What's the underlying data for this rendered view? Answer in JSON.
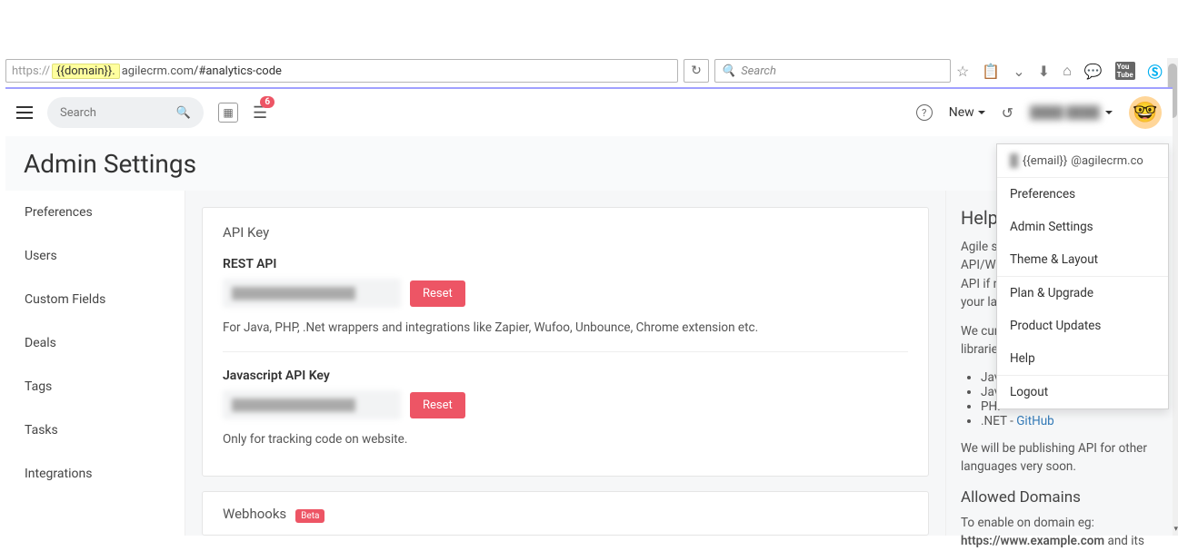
{
  "browser": {
    "url_scheme": "https://",
    "url_domain_placeholder": "{{domain}}.",
    "url_host": "agilecrm.com",
    "url_path": "/#analytics-code",
    "search_placeholder": "Search"
  },
  "topbar": {
    "search_placeholder": "Search",
    "badge_count": "6",
    "new_label": "New",
    "user_name": "████ ████"
  },
  "page_title": "Admin Settings",
  "sidebar": {
    "items": [
      {
        "label": "Preferences"
      },
      {
        "label": "Users"
      },
      {
        "label": "Custom Fields"
      },
      {
        "label": "Deals"
      },
      {
        "label": "Tags"
      },
      {
        "label": "Tasks"
      },
      {
        "label": "Integrations"
      }
    ]
  },
  "api_card": {
    "title": "API Key",
    "rest_label": "REST API",
    "rest_key": "████████████████",
    "rest_reset": "Reset",
    "rest_hint": "For Java, PHP, .Net wrappers and integrations like Zapier, Wufoo, Unbounce, Chrome extension etc.",
    "js_label": "Javascript API Key",
    "js_key": "████████████████",
    "js_reset": "Reset",
    "js_hint": "Only for tracking code on website."
  },
  "webhooks": {
    "title": "Webhooks",
    "badge": "Beta"
  },
  "help": {
    "title": "Help",
    "p1": "Agile supports multiple API/Wrappers. You can use REST API if no wrapper is supported for your language.",
    "p2": "We currently have the following libraries for Agile:",
    "items": [
      {
        "label": "Java",
        "link": ""
      },
      {
        "label": "Java",
        "link": ""
      },
      {
        "label": "PHP",
        "link": ""
      },
      {
        "label": ".NET - ",
        "link": "GitHub"
      }
    ],
    "p3": "We will be publishing API for other languages very soon.",
    "allowed_title": "Allowed Domains",
    "allowed_p": "To enable on domain eg:",
    "allowed_eg": "https://www.example.com"
  },
  "dropdown": {
    "email_placeholder": "{{email}}",
    "email_suffix": "@agilecrm.co",
    "items_a": [
      "Preferences",
      "Admin Settings",
      "Theme & Layout"
    ],
    "items_b": [
      "Plan & Upgrade",
      "Product Updates",
      "Help"
    ],
    "items_c": [
      "Logout"
    ]
  }
}
